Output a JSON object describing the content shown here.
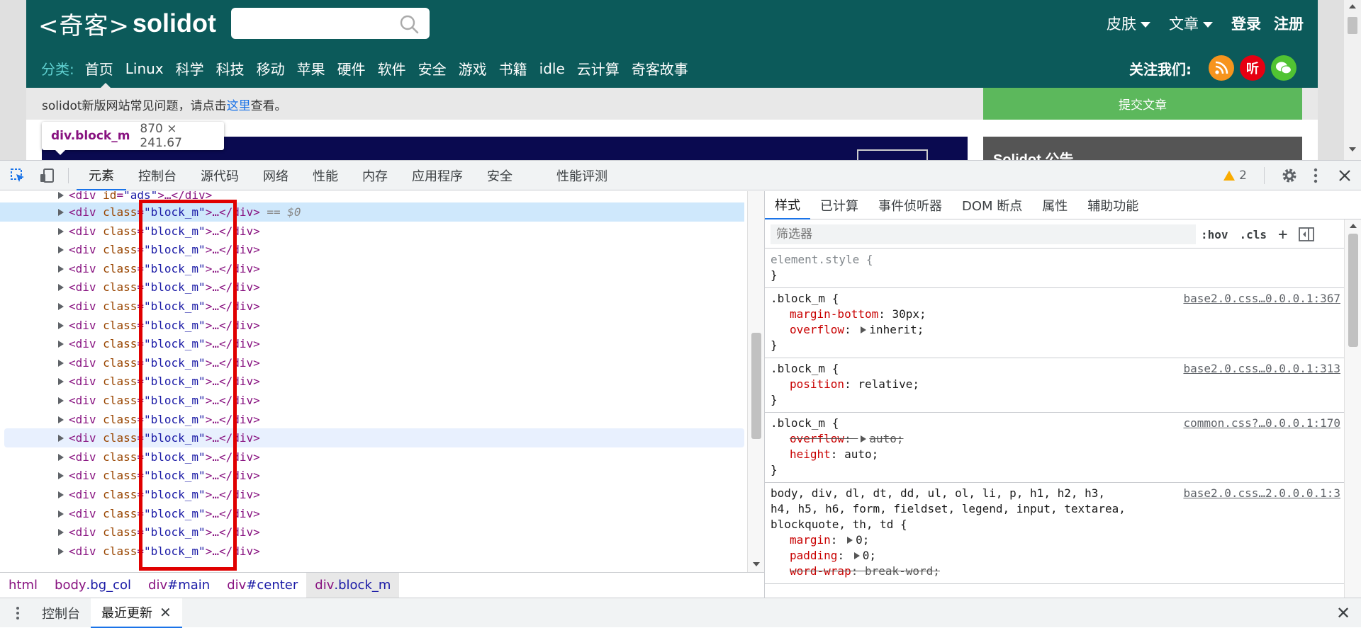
{
  "site": {
    "logo_cn": "<奇客>",
    "logo_en": "solidot",
    "search_placeholder": "",
    "top_right": [
      "皮肤",
      "文章",
      "登录",
      "注册"
    ],
    "category_label": "分类:",
    "nav": [
      "首页",
      "Linux",
      "科学",
      "科技",
      "移动",
      "苹果",
      "硬件",
      "软件",
      "安全",
      "游戏",
      "书籍",
      "idle",
      "云计算",
      "奇客故事"
    ],
    "follow_label": "关注我们:",
    "follow_icons": [
      {
        "name": "rss-icon",
        "glyph": "",
        "color": "#f7941d"
      },
      {
        "name": "listen-icon",
        "glyph": "听",
        "color": "#e60012"
      },
      {
        "name": "wechat-icon",
        "glyph": "",
        "color": "#51c332"
      }
    ],
    "notice_prefix": "solidot新版网站常见问题，请点击",
    "notice_link": "这里",
    "notice_suffix": "查看。",
    "submit_label": "提交文章",
    "announcement_title": "Solidot 公告"
  },
  "tooltip": {
    "tag": "div.block_m",
    "size": "870 × 241.67"
  },
  "devtools": {
    "tabs": [
      "元素",
      "控制台",
      "源代码",
      "网络",
      "性能",
      "内存",
      "应用程序",
      "安全",
      "性能评测"
    ],
    "active_tab": 0,
    "warning_count": "2",
    "elements": {
      "first_row": {
        "tag": "<div ",
        "attr": "id",
        "eq": "=",
        "val": "\"ads\"",
        "end": ">…</div>"
      },
      "row_open": "<div ",
      "row_attr": "class",
      "row_eq": "=",
      "row_val": "\"block_m\"",
      "row_end": ">…</div>",
      "selected_suffix": " == $0",
      "dots": "•••",
      "row_count": 19
    },
    "breadcrumbs": [
      {
        "a": "html",
        "b": ""
      },
      {
        "a": "body",
        "b": ".bg_col"
      },
      {
        "a": "div",
        "b": "#main"
      },
      {
        "a": "div",
        "b": "#center"
      },
      {
        "a": "div",
        "b": ".block_m"
      }
    ],
    "styles_tabs": [
      "样式",
      "已计算",
      "事件侦听器",
      "DOM 断点",
      "属性",
      "辅助功能"
    ],
    "filter_placeholder": "筛选器",
    "filter_actions": [
      ":hov",
      ".cls",
      "+"
    ],
    "rules": {
      "element_style": "element.style {",
      "close": "}",
      "r1": {
        "sel": ".block_m {",
        "src": "base2.0.css…0.0.0.1:367",
        "d1n": "margin-bottom",
        "d1v": ": 30px;",
        "d2n": "overflow",
        "d2v": "inherit;"
      },
      "r2": {
        "sel": ".block_m {",
        "src": "base2.0.css…0.0.0.1:313",
        "d1n": "position",
        "d1v": ": relative;"
      },
      "r3": {
        "sel": ".block_m {",
        "src": "common.css?…0.0.0.1:170",
        "d1n": "overflow",
        "d1v": "auto;",
        "d2n": "height",
        "d2v": ": auto;"
      },
      "r4": {
        "sel_line1": "body, div, dl, dt, dd, ul, ol, li, p, h1, h2, h3,",
        "sel_line2": "h4, h5, h6, form, fieldset, legend, input, textarea,",
        "sel_line3": "blockquote, th, td {",
        "src": "base2.0.css…2.0.0.0.1:3",
        "d1n": "margin",
        "d1v": "0;",
        "d2n": "padding",
        "d2v": "0;",
        "d3n": "word-wrap",
        "d3v": ": break-word;"
      }
    },
    "drawer_tabs": [
      "控制台",
      "最近更新"
    ]
  }
}
